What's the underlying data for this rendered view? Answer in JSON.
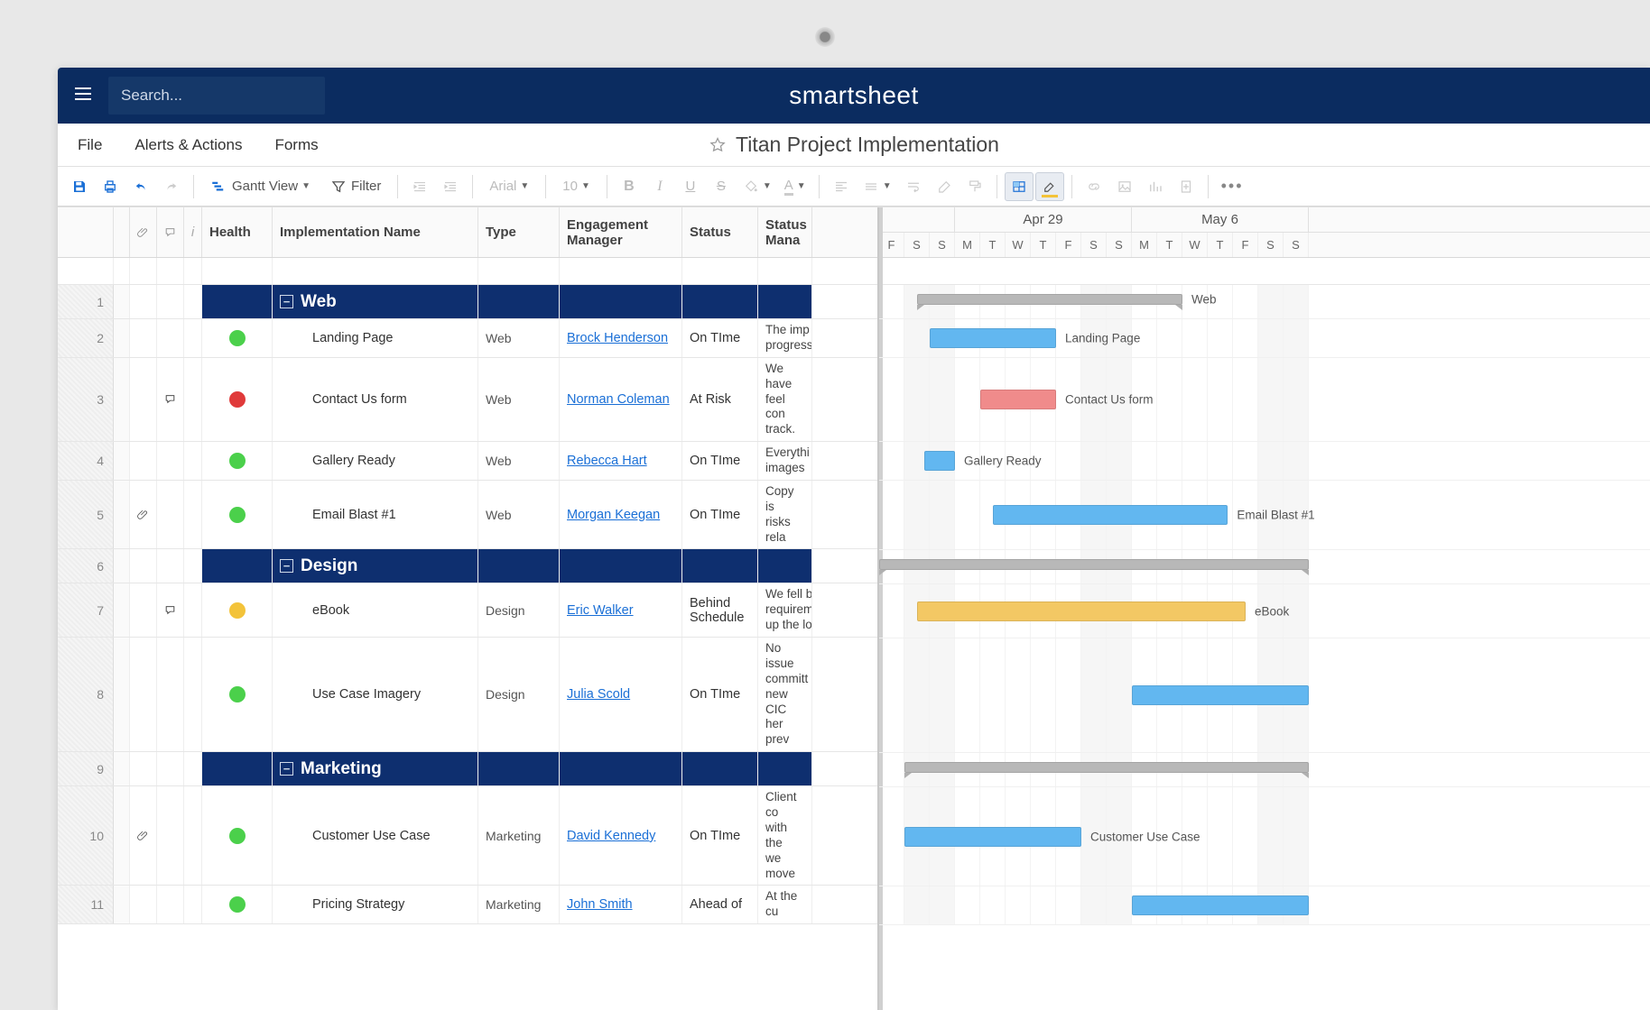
{
  "brand": "smartsheet",
  "search": {
    "placeholder": "Search..."
  },
  "menus": {
    "file": "File",
    "alerts": "Alerts & Actions",
    "forms": "Forms"
  },
  "document": {
    "title": "Titan Project Implementation"
  },
  "toolbar": {
    "view_label": "Gantt View",
    "filter_label": "Filter",
    "font_name": "Arial",
    "font_size": "10"
  },
  "columns": {
    "health": "Health",
    "name": "Implementation Name",
    "type": "Type",
    "manager": "Engagement Manager",
    "status": "Status",
    "status_mgr": "Status Mana"
  },
  "timeline": {
    "months": [
      {
        "label": "Apr 29",
        "days": 7
      },
      {
        "label": "May 6",
        "days": 7
      }
    ],
    "pre_days": [
      "F",
      "S",
      "S"
    ],
    "day_labels": [
      "M",
      "T",
      "W",
      "T",
      "F",
      "S",
      "S",
      "M",
      "T",
      "W",
      "T",
      "F",
      "S",
      "S"
    ],
    "post_days": []
  },
  "rows": [
    {
      "n": 1,
      "kind": "section",
      "name": "Web",
      "bar_start": 1.5,
      "bar_len": 10.5,
      "bar_label": "Web"
    },
    {
      "n": 2,
      "kind": "task",
      "health": "green",
      "name": "Landing Page",
      "type": "Web",
      "mgr": "Brock Henderson",
      "status": "On TIme",
      "note": "The imp\nprogress",
      "bar_start": 2,
      "bar_len": 5,
      "color": "blue",
      "bar_label": "Landing Page"
    },
    {
      "n": 3,
      "kind": "task",
      "health": "red",
      "name": "Contact Us form",
      "type": "Web",
      "mgr": "Norman Coleman",
      "status": "At Risk",
      "note": "We have\nfeel con\ntrack.",
      "comment": true,
      "bar_start": 4,
      "bar_len": 3,
      "color": "red",
      "bar_label": "Contact Us form"
    },
    {
      "n": 4,
      "kind": "task",
      "health": "green",
      "name": "Gallery Ready",
      "type": "Web",
      "mgr": "Rebecca Hart",
      "status": "On TIme",
      "note": "Everythi\nimages",
      "bar_start": 1.8,
      "bar_len": 1.2,
      "color": "blue",
      "bar_label": "Gallery Ready"
    },
    {
      "n": 5,
      "kind": "task",
      "health": "green",
      "name": "Email Blast #1",
      "type": "Web",
      "mgr": "Morgan Keegan",
      "status": "On TIme",
      "note": "Copy is\nrisks rela",
      "attach": true,
      "bar_start": 4.5,
      "bar_len": 9.3,
      "color": "blue",
      "bar_label": "Email Blast #1"
    },
    {
      "n": 6,
      "kind": "section",
      "name": "Design",
      "bar_start": 0,
      "bar_len": 17,
      "bar_label": ""
    },
    {
      "n": 7,
      "kind": "task",
      "health": "yellow",
      "name": "eBook",
      "type": "Design",
      "mgr": "Eric Walker",
      "status": "Behind Schedule",
      "note": "We fell b\nrequirem\nup the lo",
      "comment": true,
      "bar_start": 1.5,
      "bar_len": 13,
      "color": "yellow",
      "bar_label": "eBook"
    },
    {
      "n": 8,
      "kind": "task",
      "health": "green",
      "name": "Use Case Imagery",
      "type": "Design",
      "mgr": "Julia Scold",
      "status": "On TIme",
      "note": "No issue\ncommitt\nnew CIC\nher prev",
      "bar_start": 10,
      "bar_len": 7,
      "color": "blue",
      "bar_label": ""
    },
    {
      "n": 9,
      "kind": "section",
      "name": "Marketing",
      "bar_start": 1,
      "bar_len": 16,
      "bar_label": ""
    },
    {
      "n": 10,
      "kind": "task",
      "health": "green",
      "name": "Customer Use Case",
      "type": "Marketing",
      "mgr": "David Kennedy",
      "status": "On TIme",
      "note": "Client co\nwith the\nwe move",
      "attach": true,
      "bar_start": 1,
      "bar_len": 7,
      "color": "blue",
      "bar_label": "Customer Use Case"
    },
    {
      "n": 11,
      "kind": "task",
      "health": "green",
      "name": "Pricing Strategy",
      "type": "Marketing",
      "mgr": "John Smith",
      "status": "Ahead of",
      "note": "At the cu",
      "bar_start": 10,
      "bar_len": 7,
      "color": "blue",
      "bar_label": ""
    }
  ]
}
